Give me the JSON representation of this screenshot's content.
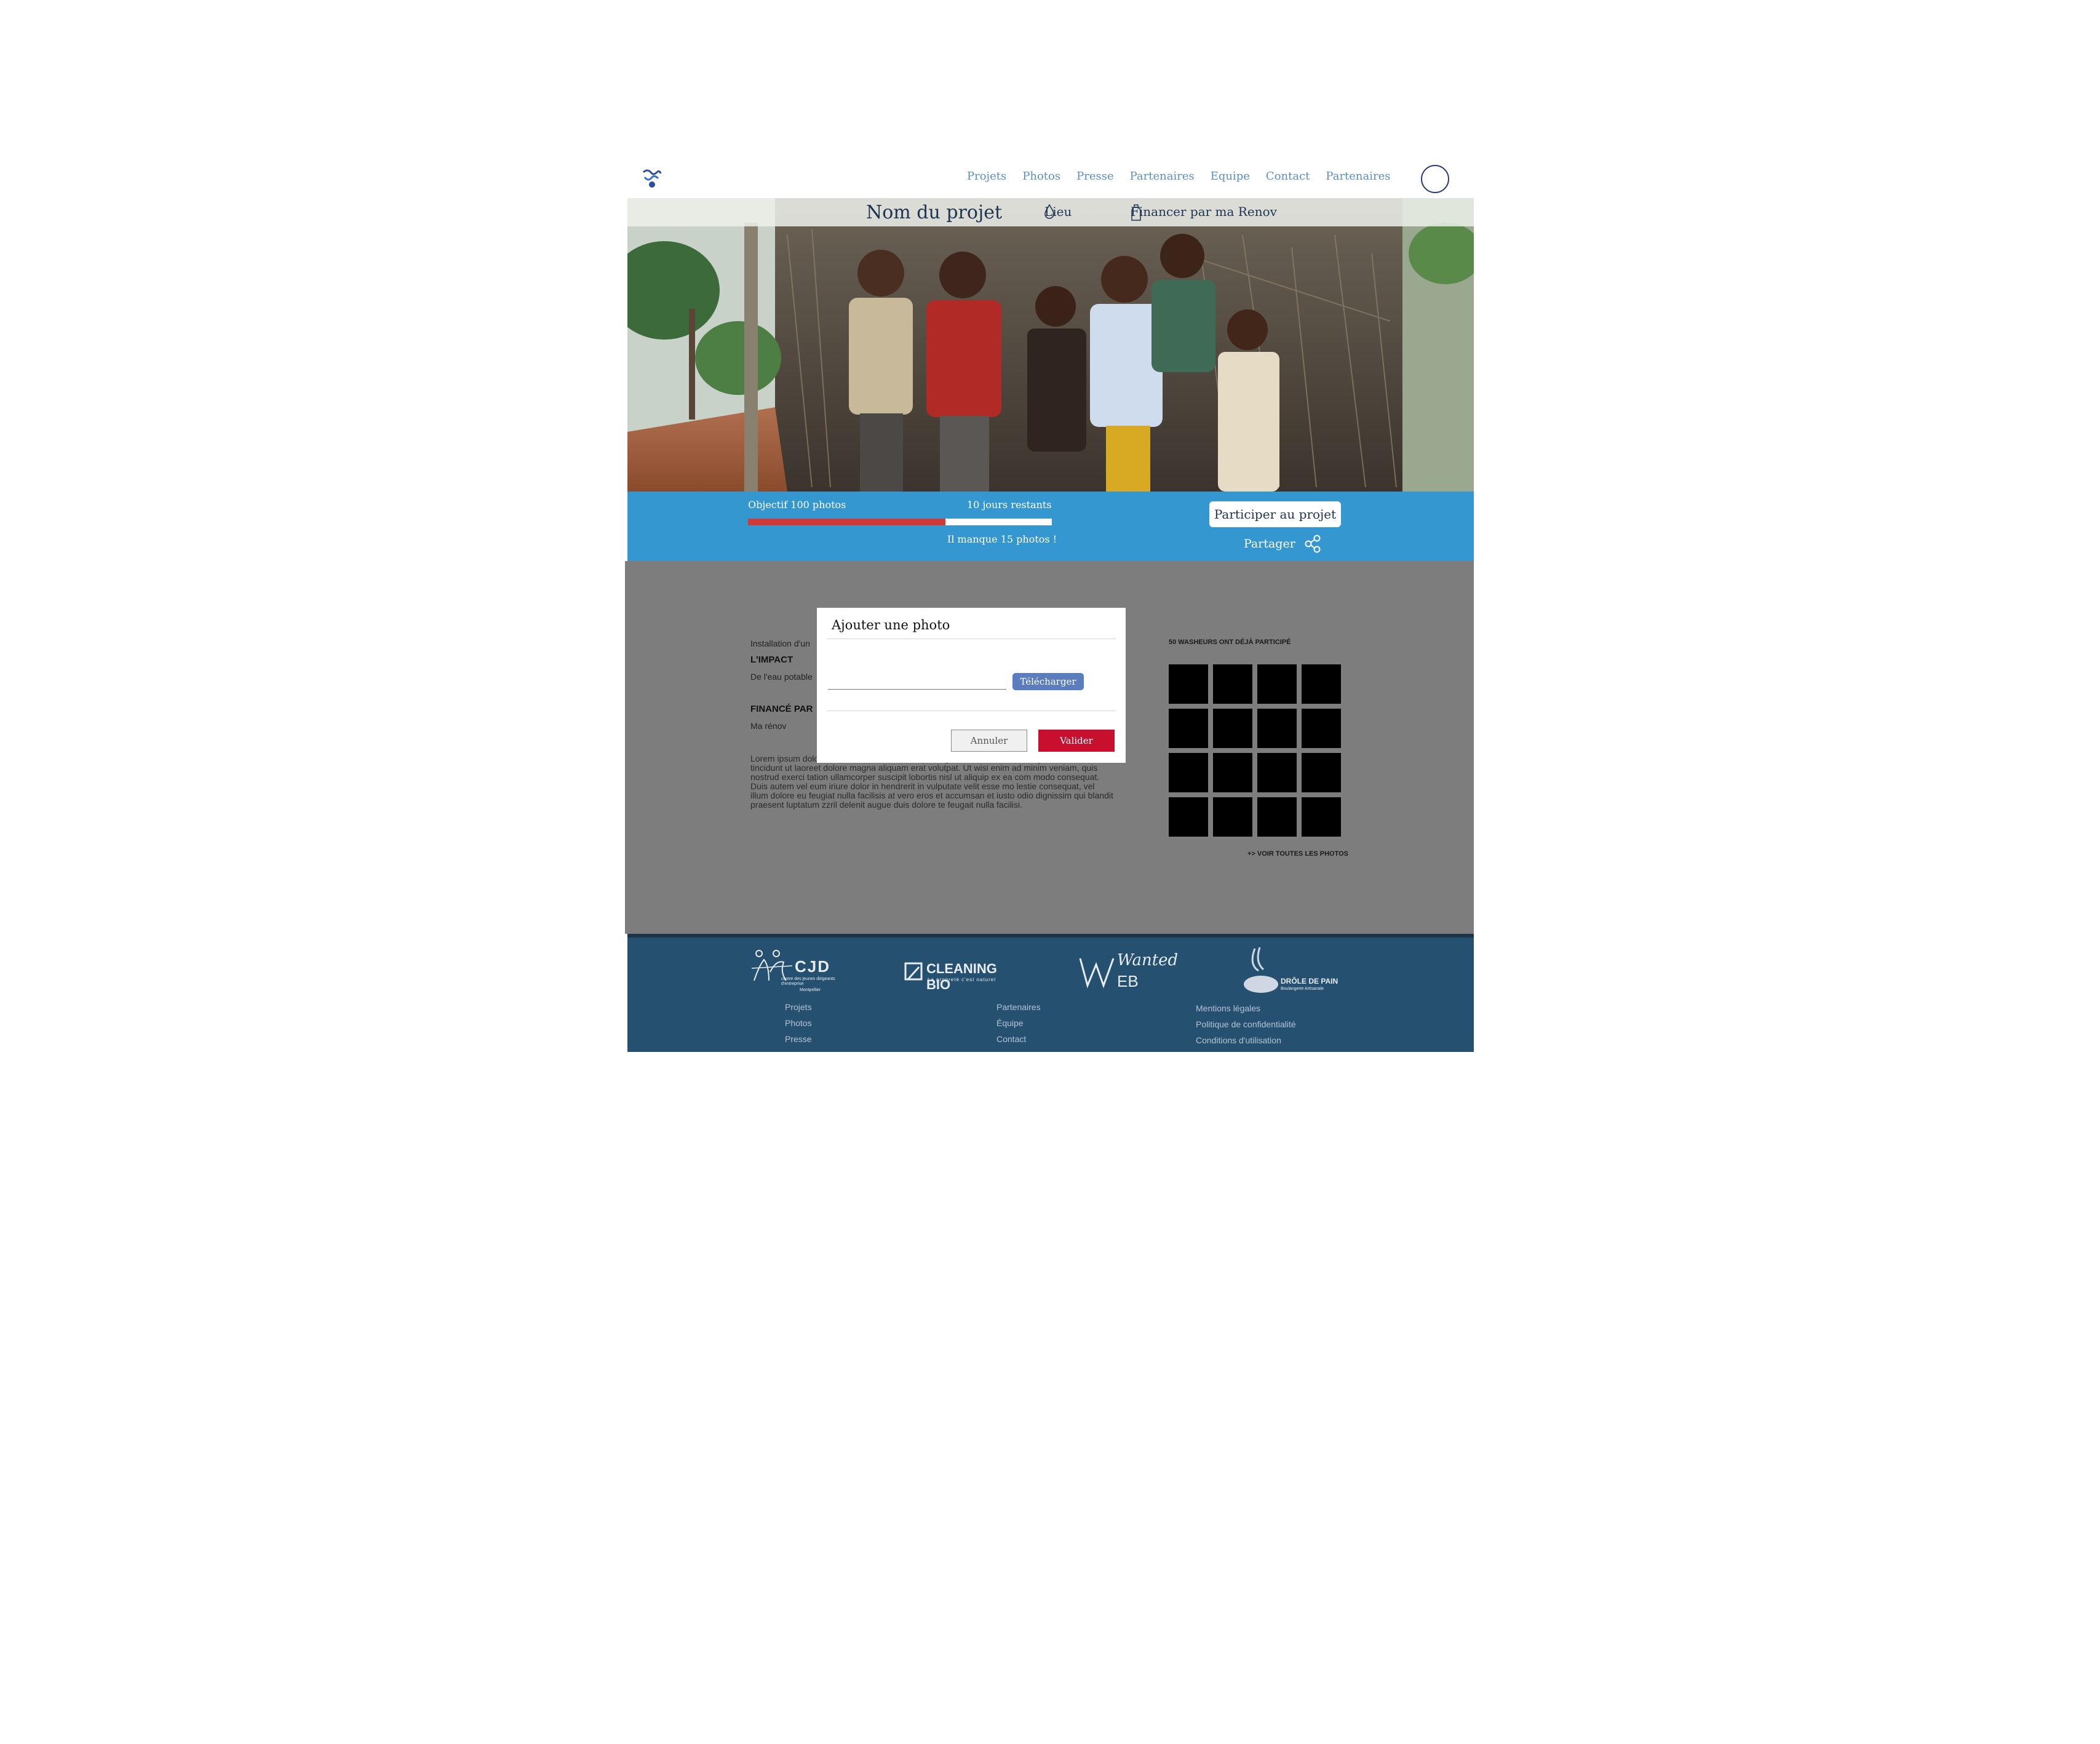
{
  "nav": {
    "items": [
      "Projets",
      "Photos",
      "Presse",
      "Partenaires",
      "Equipe",
      "Contact",
      "Partenaires"
    ]
  },
  "hero": {
    "title": "Nom du projet",
    "lieu": "Lieu",
    "finance": "Financer par ma Renov"
  },
  "progress": {
    "objective": "Objectif 100 photos",
    "days_left": "10 jours restants",
    "missing": "Il manque 15 photos !",
    "fraction": 0.65
  },
  "actions": {
    "participate": "Participer au projet",
    "share": "Partager"
  },
  "content": {
    "intro": "Installation d'un",
    "impact_heading": "L'IMPACT",
    "impact_text": "De l'eau potable",
    "financed_heading": "FINANCÉ PAR",
    "financed_text": "Ma rénov",
    "lorem": "Lorem ipsum dolor sit amet, consectetuer adipiscing elit, sed diam nonummy nibh euis mod tincidunt ut laoreet dolore magna aliquam erat volutpat. Ut wisi enim ad minim veniam, quis nostrud exerci tation ullamcorper suscipit lobortis nisl ut aliquip ex ea com modo consequat. Duis autem vel eum iriure dolor in hendrerit in vulputate velit esse mo lestie consequat, vel illum dolore eu feugiat nulla facilisis at vero eros et accumsan et iusto odio dignissim qui blandit praesent luptatum zzril delenit augue duis dolore te feugait nulla facilisi.",
    "grid_title": "50 WASHEURS ONT DÉJÀ PARTICIPÉ",
    "see_all": "+> VOIR TOUTES LES PHOTOS"
  },
  "modal": {
    "title": "Ajouter une photo",
    "upload": "Télécharger",
    "cancel": "Annuler",
    "validate": "Valider"
  },
  "footer": {
    "logos": {
      "cjd": "CJD",
      "cjd_sub": "centre des jeunes dirigeants d'entreprise",
      "cjd_city": "Montpellier",
      "cleaning": "CLEANING BIO",
      "cleaning_sub": "La propreté c'est naturel",
      "wanted": "Wanted",
      "web": "EB",
      "drole": "DRÔLE DE PAIN",
      "drole_sub": "Boulangerie Artisanale"
    },
    "col1": [
      "Projets",
      "Photos",
      "Presse"
    ],
    "col2": [
      "Partenaires",
      "Équipe",
      "Contact"
    ],
    "col3": [
      "Mentions légales",
      "Politique de confidentialité",
      "Conditions d'utilisation"
    ]
  },
  "colors": {
    "accent_blue": "#3597cf",
    "footer": "#25506f",
    "danger": "#c8102e",
    "upload": "#5b7dc0"
  }
}
